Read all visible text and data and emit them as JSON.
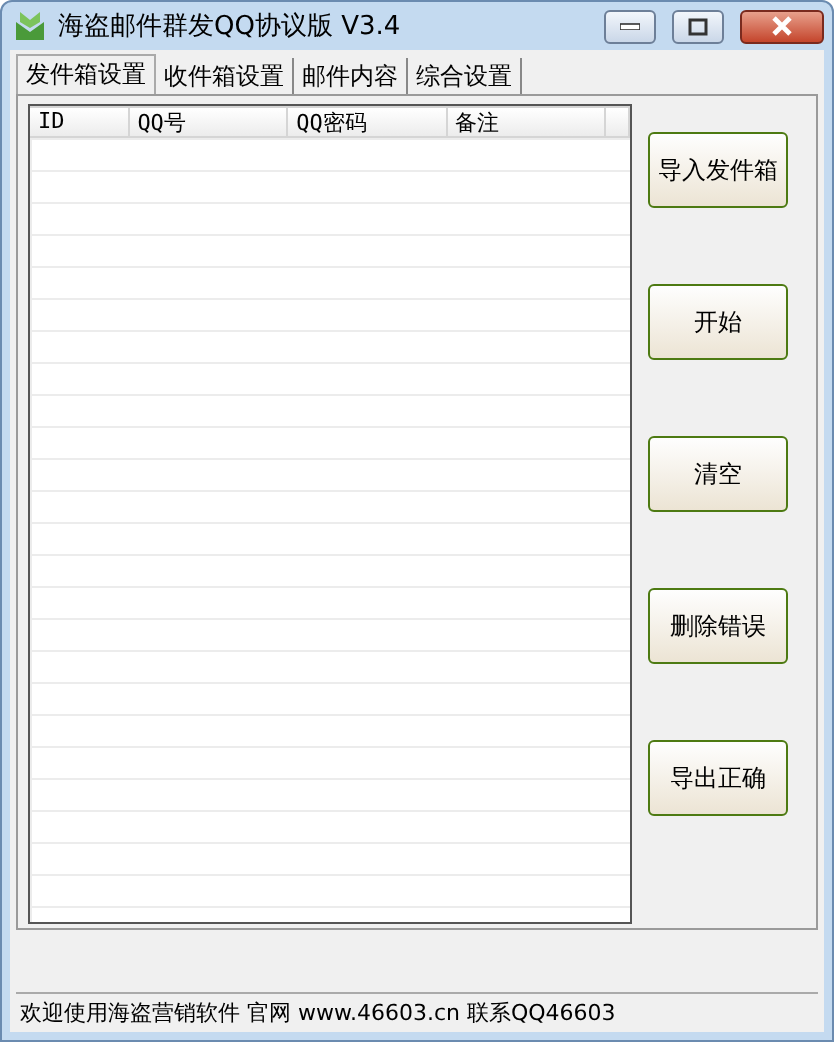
{
  "window": {
    "title": "海盗邮件群发QQ协议版 V3.4"
  },
  "tabs": [
    {
      "label": "发件箱设置",
      "selected": true
    },
    {
      "label": "收件箱设置",
      "selected": false
    },
    {
      "label": "邮件内容",
      "selected": false
    },
    {
      "label": "综合设置",
      "selected": false
    }
  ],
  "table": {
    "columns": [
      "ID",
      "QQ号",
      "QQ密码",
      "备注"
    ]
  },
  "buttons": [
    "导入发件箱",
    "开始",
    "清空",
    "删除错误",
    "导出正确"
  ],
  "status_bar": "欢迎使用海盗营销软件 官网 www.46603.cn 联系QQ46603"
}
